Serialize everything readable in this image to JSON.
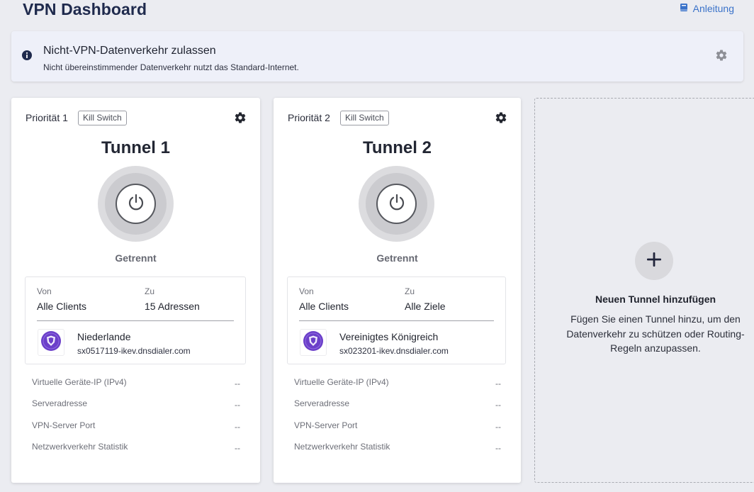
{
  "header": {
    "title": "VPN Dashboard",
    "guide_label": "Anleitung"
  },
  "banner": {
    "title": "Nicht-VPN-Datenverkehr zulassen",
    "subtitle": "Nicht übereinstimmender Datenverkehr nutzt das Standard-Internet."
  },
  "tunnels": [
    {
      "priority": "Priorität 1",
      "kill_switch": "Kill Switch",
      "name": "Tunnel 1",
      "status": "Getrennt",
      "from_label": "Von",
      "from_value": "Alle Clients",
      "to_label": "Zu",
      "to_value": "15 Adressen",
      "server_country": "Niederlande",
      "server_host": "sx0517119-ikev.dnsdialer.com",
      "stats": [
        {
          "label": "Virtuelle Geräte-IP (IPv4)",
          "value": "--"
        },
        {
          "label": "Serveradresse",
          "value": "--"
        },
        {
          "label": "VPN-Server Port",
          "value": "--"
        },
        {
          "label": "Netzwerkverkehr Statistik",
          "value": "--"
        }
      ]
    },
    {
      "priority": "Priorität 2",
      "kill_switch": "Kill Switch",
      "name": "Tunnel 2",
      "status": "Getrennt",
      "from_label": "Von",
      "from_value": "Alle Clients",
      "to_label": "Zu",
      "to_value": "Alle Ziele",
      "server_country": "Vereinigtes Königreich",
      "server_host": "sx023201-ikev.dnsdialer.com",
      "stats": [
        {
          "label": "Virtuelle Geräte-IP (IPv4)",
          "value": "--"
        },
        {
          "label": "Serveradresse",
          "value": "--"
        },
        {
          "label": "VPN-Server Port",
          "value": "--"
        },
        {
          "label": "Netzwerkverkehr Statistik",
          "value": "--"
        }
      ]
    }
  ],
  "add_tunnel": {
    "title": "Neuen Tunnel hinzufügen",
    "description": "Fügen Sie einen Tunnel hinzu, um den Datenverkehr zu schützen oder Routing-Regeln anzupassen."
  },
  "icons": {
    "guide": "book-icon",
    "info": "info-icon",
    "settings": "gear-icon",
    "power": "power-icon",
    "vpn_provider": "shield-icon",
    "add": "plus-icon"
  },
  "colors": {
    "accent": "#3a72c9",
    "title": "#1f2a4d",
    "vpn_badge": "#6b3fc9",
    "background": "#ebecf1"
  }
}
